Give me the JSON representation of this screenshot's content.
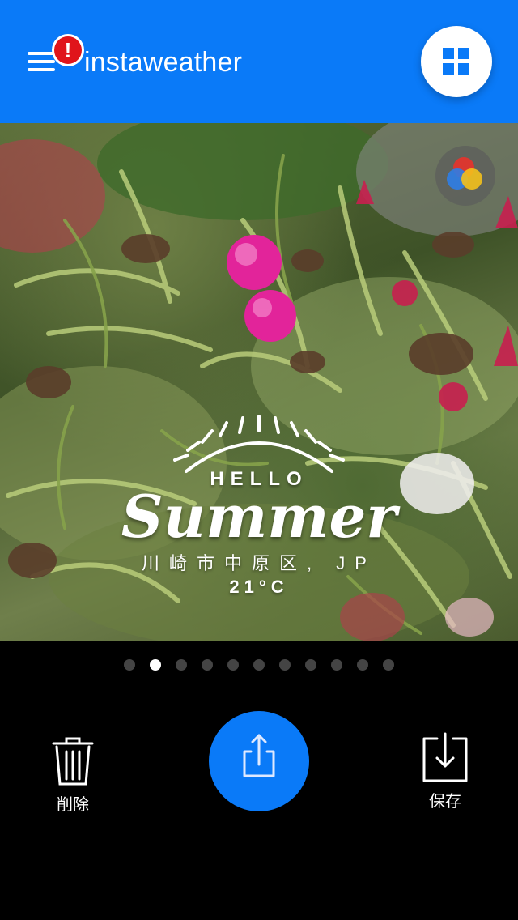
{
  "header": {
    "title": "instaweather",
    "alert_badge": "!",
    "menu_icon": "hamburger-menu-icon",
    "grid_icon": "grid-view-icon"
  },
  "photo": {
    "filter_icon": "color-filter-icon",
    "overlay": {
      "hello": "HELLO",
      "summer": "Summer",
      "location": "川崎市中原区, JP",
      "temperature": "21°C"
    }
  },
  "pager": {
    "count": 11,
    "active_index": 1
  },
  "actions": {
    "delete_label": "削除",
    "share_icon": "share-icon",
    "save_label": "保存"
  },
  "colors": {
    "accent": "#0a7af8",
    "alert": "#e0141b",
    "background": "#000000"
  }
}
